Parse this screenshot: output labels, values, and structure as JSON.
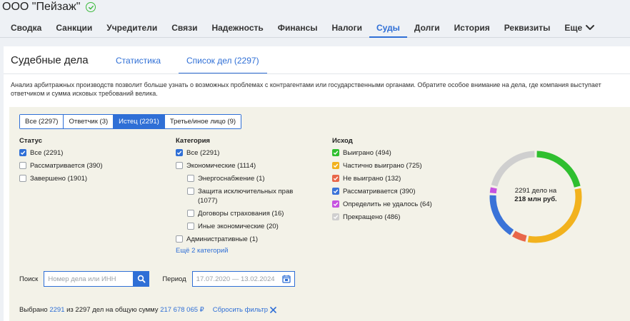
{
  "company": {
    "name": "ООО \"Пейзаж\""
  },
  "nav": {
    "items": [
      {
        "label": "Сводка",
        "active": false
      },
      {
        "label": "Санкции",
        "active": false
      },
      {
        "label": "Учредители",
        "active": false
      },
      {
        "label": "Связи",
        "active": false
      },
      {
        "label": "Надежность",
        "active": false
      },
      {
        "label": "Финансы",
        "active": false
      },
      {
        "label": "Налоги",
        "active": false
      },
      {
        "label": "Суды",
        "active": true
      },
      {
        "label": "Долги",
        "active": false
      },
      {
        "label": "История",
        "active": false
      },
      {
        "label": "Реквизиты",
        "active": false
      }
    ],
    "more": "Еще"
  },
  "panel": {
    "title": "Судебные дела",
    "tabs": [
      {
        "label": "Статистика",
        "active": false
      },
      {
        "label": "Список дел (2297)",
        "active": true
      }
    ],
    "description": "Анализ арбитражных производств позволит больше узнать о возможных проблемах с контрагентами или государственными органами. Обратите особое внимание на дела, где компания выступает ответчиком и сумма исковых требований велика."
  },
  "role_filter": [
    {
      "label": "Все (2297)",
      "active": false
    },
    {
      "label": "Ответчик (3)",
      "active": false
    },
    {
      "label": "Истец (2291)",
      "active": true
    },
    {
      "label": "Третье/иное лицо (9)",
      "active": false
    }
  ],
  "status": {
    "title": "Статус",
    "items": [
      {
        "label": "Все (2291)",
        "checked": true
      },
      {
        "label": "Рассматривается (390)",
        "checked": false
      },
      {
        "label": "Завершено (1901)",
        "checked": false
      }
    ]
  },
  "category": {
    "title": "Категория",
    "items": [
      {
        "label": "Все (2291)",
        "checked": true
      },
      {
        "label": "Экономические (1114)",
        "checked": false
      },
      {
        "label": "Энергоснабжение (1)",
        "checked": false
      },
      {
        "label": "Защита исключительных прав (1077)",
        "checked": false
      },
      {
        "label": "Договоры страхования (16)",
        "checked": false
      },
      {
        "label": "Иные экономические (20)",
        "checked": false
      },
      {
        "label": "Административные (1)",
        "checked": false
      }
    ],
    "more_link": "Ещё 2 категорий"
  },
  "outcome": {
    "title": "Исход",
    "items": [
      {
        "label": "Выиграно (494)",
        "color": "#2fbf2f"
      },
      {
        "label": "Частично выиграно (725)",
        "color": "#f2b21d"
      },
      {
        "label": "Не выиграно (132)",
        "color": "#e8674a"
      },
      {
        "label": "Рассматривается (390)",
        "color": "#3a73d8"
      },
      {
        "label": "Определить не удалось (64)",
        "color": "#c653e0"
      },
      {
        "label": "Прекращено (486)",
        "color": "#cfcfcf"
      }
    ]
  },
  "chart_data": {
    "type": "pie",
    "categories": [
      "Выиграно",
      "Частично выиграно",
      "Не выиграно",
      "Рассматривается",
      "Определить не удалось",
      "Прекращено"
    ],
    "values": [
      494,
      725,
      132,
      390,
      64,
      486
    ],
    "colors": [
      "#2fbf2f",
      "#f2b21d",
      "#e8674a",
      "#3a73d8",
      "#c653e0",
      "#cfcfcf"
    ],
    "center_line1": "2291 дело на",
    "center_line2": "218 млн руб."
  },
  "search": {
    "label": "Поиск",
    "placeholder": "Номер дела или ИНН",
    "period_label": "Период",
    "period_value": "17.07.2020 — 13.02.2024"
  },
  "summary": {
    "prefix": "Выбрано",
    "selected": "2291",
    "middle": "из 2297 дел на общую сумму",
    "amount": "217 678 065 ₽",
    "reset": "Сбросить фильтр"
  }
}
